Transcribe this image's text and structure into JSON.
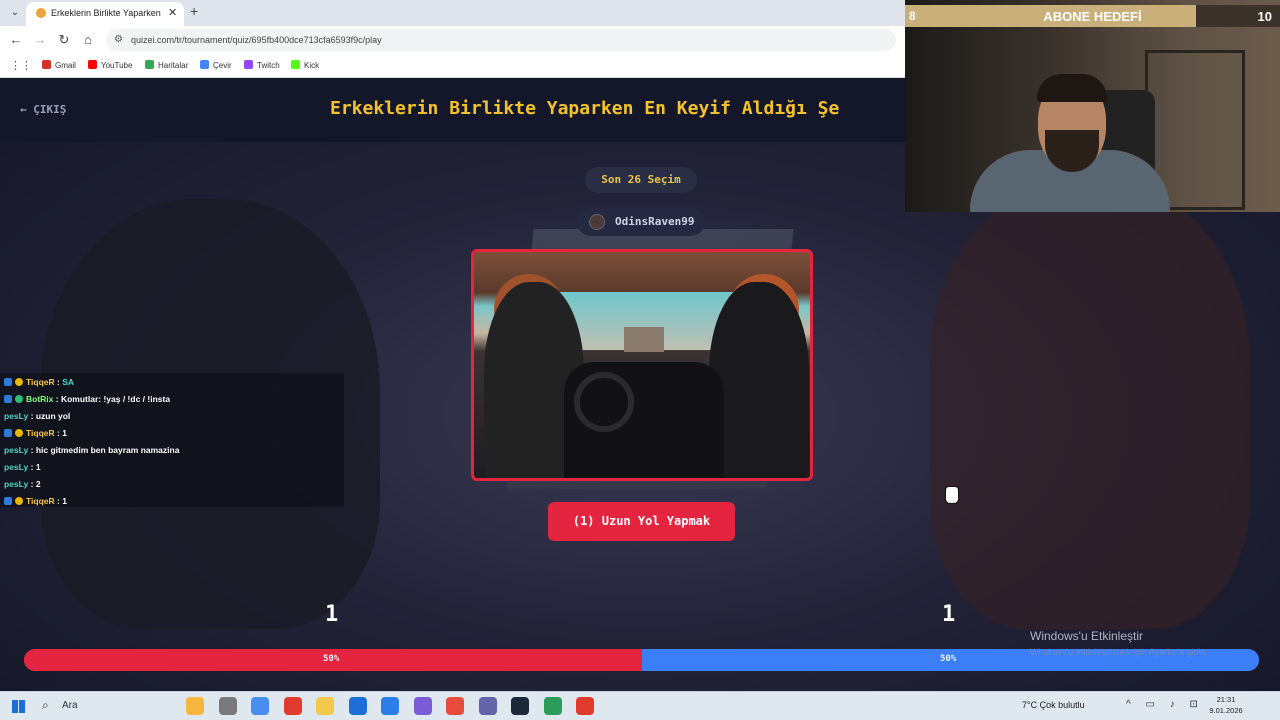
{
  "browser": {
    "tab_title": "Erkeklerin Birlikte Yaparken En K",
    "url": "quizei.com/tr/tournament/quiz/695fb400dce713cfa6593f9c/play",
    "bookmarks": [
      {
        "label": "Gmail",
        "color": "#d93025"
      },
      {
        "label": "YouTube",
        "color": "#ff0000"
      },
      {
        "label": "Haritalar",
        "color": "#34a853"
      },
      {
        "label": "Çevir",
        "color": "#4285f4"
      },
      {
        "label": "Twitch",
        "color": "#9146ff"
      },
      {
        "label": "Kick",
        "color": "#53fc18"
      }
    ]
  },
  "app": {
    "exit_label": "ÇIKIŞ",
    "title": "Erkeklerin Birlikte Yaparken En Keyif Aldığı Şe",
    "last_label": "Son 26 Seçim",
    "username": "OdinsRaven99",
    "choice_label": "(1) Uzun Yol Yapmak",
    "score_left": "1",
    "score_right": "1",
    "vote_left_label": "50%",
    "vote_right_label": "50%",
    "vote_left_fraction": 0.5,
    "colors": {
      "accent_red": "#e5243f",
      "accent_blue": "#3b7ef5",
      "title_yellow": "#f5c22a"
    }
  },
  "chat": [
    {
      "user": "TiqqeR",
      "color": "#f5c542",
      "text": "SA",
      "text_color": "#3ee0c8",
      "badges": [
        "mod",
        "vip"
      ]
    },
    {
      "user": "BotRix",
      "color": "#7dff7a",
      "text": "Komutlar: !yaş / !dc / !insta",
      "text_color": "#ffffff",
      "badges": [
        "mod",
        "bot"
      ]
    },
    {
      "user": "pesLy",
      "color": "#4fd1c5",
      "text": "uzun yol",
      "text_color": "#ffffff",
      "badges": []
    },
    {
      "user": "TiqqeR",
      "color": "#f5c542",
      "text": "1",
      "text_color": "#ffffff",
      "badges": [
        "mod",
        "vip"
      ]
    },
    {
      "user": "pesLy",
      "color": "#4fd1c5",
      "text": "hic gitmedim ben bayram namazina",
      "text_color": "#ffffff",
      "badges": []
    },
    {
      "user": "pesLy",
      "color": "#4fd1c5",
      "text": "1",
      "text_color": "#ffffff",
      "badges": []
    },
    {
      "user": "pesLy",
      "color": "#4fd1c5",
      "text": "2",
      "text_color": "#ffffff",
      "badges": []
    },
    {
      "user": "TiqqeR",
      "color": "#f5c542",
      "text": "1",
      "text_color": "#ffffff",
      "badges": [
        "mod",
        "vip"
      ]
    }
  ],
  "stream_goal": {
    "title": "ABONE HEDEFİ",
    "current": "8",
    "target": "10",
    "progress_fraction": 0.8
  },
  "windows": {
    "activate_title": "Windows'u Etkinleştir",
    "activate_sub": "Windows'u etkinleştirmek için Ayarlar'a gidin.",
    "search_label": "Ara",
    "weather": "7°C  Çok bulutlu",
    "time": "21:31",
    "date": "9.01.2026",
    "taskbar_apps": [
      "#f6b73c",
      "#7a7a7a",
      "#4a8df0",
      "#e23b2e",
      "#f2c94c",
      "#1e6ed8",
      "#2b7de9",
      "#7b5cd6",
      "#e84a3c",
      "#6264a7",
      "#1b2838",
      "#2c9c5a",
      "#e23b2e"
    ]
  }
}
